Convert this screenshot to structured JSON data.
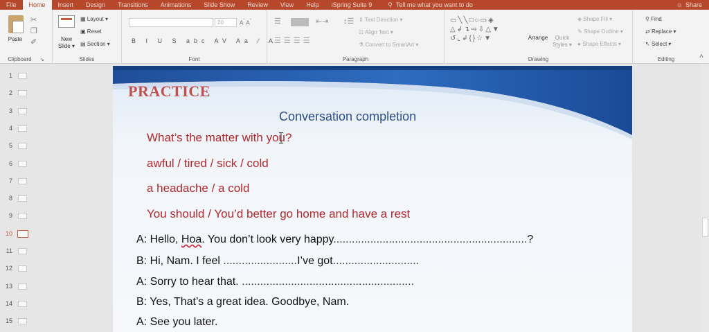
{
  "tabs": {
    "file": "File",
    "home": "Home",
    "insert": "Insert",
    "design": "Design",
    "transitions": "Transitions",
    "animations": "Animations",
    "slideshow": "Slide Show",
    "review": "Review",
    "view": "View",
    "help": "Help",
    "ispring": "iSpring Suite 9",
    "tell_me": "Tell me what you want to do",
    "share": "Share"
  },
  "ribbon": {
    "clipboard": {
      "label": "Clipboard",
      "paste": "Paste"
    },
    "slides": {
      "label": "Slides",
      "new_slide": "New",
      "new_slide_2": "Slide",
      "layout": "Layout",
      "reset": "Reset",
      "section": "Section"
    },
    "font": {
      "label": "Font",
      "size": "20"
    },
    "paragraph": {
      "label": "Paragraph",
      "text_direction": "Text Direction",
      "align_text": "Align Text",
      "convert_smartart": "Convert to SmartArt"
    },
    "drawing": {
      "label": "Drawing",
      "arrange": "Arrange",
      "quick_styles": "Quick",
      "quick_styles_2": "Styles",
      "shape_fill": "Shape Fill",
      "shape_outline": "Shape Outline",
      "shape_effects": "Shape Effects"
    },
    "editing": {
      "label": "Editing",
      "find": "Find",
      "replace": "Replace",
      "select": "Select"
    }
  },
  "thumbnails": [
    "1",
    "2",
    "3",
    "4",
    "5",
    "6",
    "7",
    "8",
    "9",
    "10",
    "11",
    "12",
    "13",
    "14",
    "15"
  ],
  "active_slide": "10",
  "slide": {
    "title": "PRACTICE",
    "subtitle": "Conversation completion",
    "options": [
      "What’s the matter with you?",
      "awful / tired / sick / cold",
      "a headache / a cold",
      "You should / You’d better go home and have a rest"
    ],
    "dialog": {
      "l1_a": "A: Hello, ",
      "l1_name": "Hoa",
      "l1_b": ". You don’t look very happy",
      "l1_dots": "...............................................................",
      "l1_end": "?",
      "l2_a": "B: Hi, Nam. I feel ",
      "l2_dots1": "........................",
      "l2_b": "I’ve got",
      "l2_dots2": "............................",
      "l3_a": "A: Sorry to hear that. ",
      "l3_dots": "........................................................",
      "l4": "B: Yes, That’s a great idea. Goodbye, Nam.",
      "l5": "A: See you later."
    }
  },
  "colors": {
    "accent": "#b7472a",
    "title_red": "#c0504d",
    "subtitle_blue": "#2e4e8f",
    "option_red": "#b3282a"
  }
}
